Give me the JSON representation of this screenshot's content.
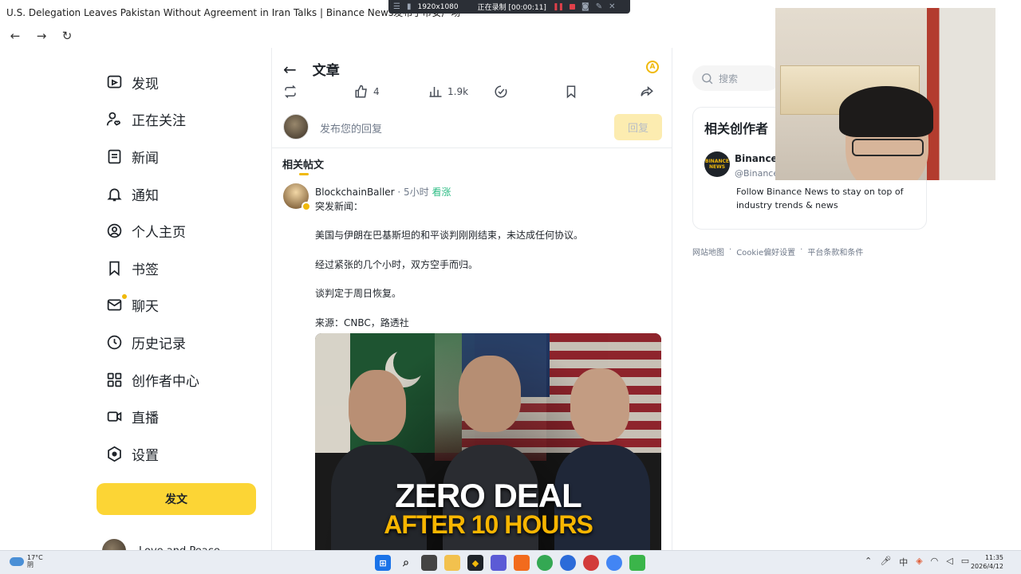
{
  "window": {
    "title": "U.S. Delegation Leaves Pakistan Without Agreement in Iran Talks | Binance News发布于币安广场",
    "recorder": {
      "resolution": "1920x1080",
      "status": "正在录制 [00:00:11]"
    }
  },
  "sidebar": {
    "items": [
      {
        "label": "发现",
        "icon": "discover-icon"
      },
      {
        "label": "正在关注",
        "icon": "following-icon"
      },
      {
        "label": "新闻",
        "icon": "news-icon"
      },
      {
        "label": "通知",
        "icon": "bell-icon"
      },
      {
        "label": "个人主页",
        "icon": "profile-icon"
      },
      {
        "label": "书签",
        "icon": "bookmark-icon"
      },
      {
        "label": "聊天",
        "icon": "chat-icon"
      },
      {
        "label": "历史记录",
        "icon": "history-icon"
      },
      {
        "label": "创作者中心",
        "icon": "creator-center-icon"
      },
      {
        "label": "直播",
        "icon": "live-icon"
      },
      {
        "label": "设置",
        "icon": "settings-icon"
      }
    ],
    "post_button": "发文",
    "user_name": "Love and Peace"
  },
  "article": {
    "header_title": "文章",
    "actions": {
      "likes": "4",
      "views": "1.9k"
    },
    "reply_placeholder": "发布您的回复",
    "reply_button": "回复",
    "related_tab": "相关帖文"
  },
  "post": {
    "author": "BlockchainBaller",
    "time": "· 5小时",
    "tag": "看涨",
    "lines": [
      "突发新闻：",
      "美国与伊朗在巴基斯坦的和平谈判刚刚结束，未达成任何协议。",
      "经过紧张的几个小时，双方空手而归。",
      "谈判定于周日恢复。",
      "来源：CNBC，路透社"
    ],
    "image_text": {
      "line1": "ZERO DEAL",
      "line2": "AFTER 10 HOURS"
    }
  },
  "right": {
    "search_placeholder": "搜索",
    "creators_title": "相关创作者",
    "creator": {
      "name": "Binance N",
      "handle": "@Binance",
      "avatar_text": "BINANCE NEWS",
      "description": "Follow Binance News to stay on top of industry trends & news"
    },
    "footer_links": [
      "网站地图",
      "Cookie偏好设置",
      "平台条款和条件"
    ],
    "footer_sep": "·"
  },
  "taskbar": {
    "weather_temp": "17°C",
    "weather_desc": "阴",
    "ime": "中",
    "time": "11:35",
    "date": "2026/4/12"
  },
  "colors": {
    "accent": "#fcd535",
    "bullish": "#2ebd85",
    "brand": "#f0b90b"
  }
}
